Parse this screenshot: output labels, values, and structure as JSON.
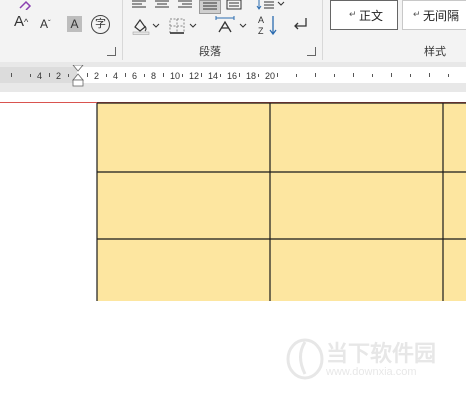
{
  "ribbon": {
    "font_size_up": "A",
    "font_size_down": "A",
    "char_shading": "A",
    "phonetic": "字",
    "paragraph_group": "段落",
    "styles_group": "样式",
    "style_normal": "正文",
    "style_no_spacing": "无间隔"
  },
  "ruler": {
    "labels": [
      "4",
      "2",
      "2",
      "4",
      "6",
      "8",
      "10",
      "12",
      "14",
      "16",
      "18",
      "20"
    ]
  },
  "table": {
    "cell_color": "#fde6a0",
    "border_color": "#1a1a1a"
  },
  "watermark": {
    "title": "当下软件园",
    "url": "www.downxia.com"
  }
}
